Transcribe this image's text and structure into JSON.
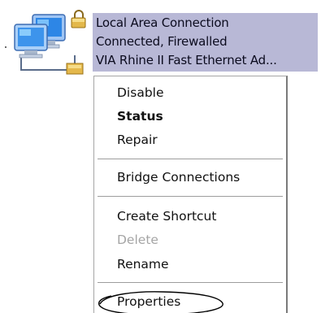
{
  "connection": {
    "name": "Local Area Connection",
    "status": "Connected, Firewalled",
    "device": "VIA Rhine II Fast Ethernet Ad..."
  },
  "icons": {
    "connection_icon": "network-computers-icon",
    "lock_icon": "lock-icon",
    "annotation": "ellipse-highlight"
  },
  "menu": {
    "disable": "Disable",
    "status": "Status",
    "repair": "Repair",
    "bridge": "Bridge Connections",
    "create_shortcut": "Create Shortcut",
    "delete": "Delete",
    "rename": "Rename",
    "properties": "Properties"
  },
  "colors": {
    "selection": "#b8b8d6",
    "disabled_text": "#a5a5a5",
    "annotation": "#000000"
  }
}
